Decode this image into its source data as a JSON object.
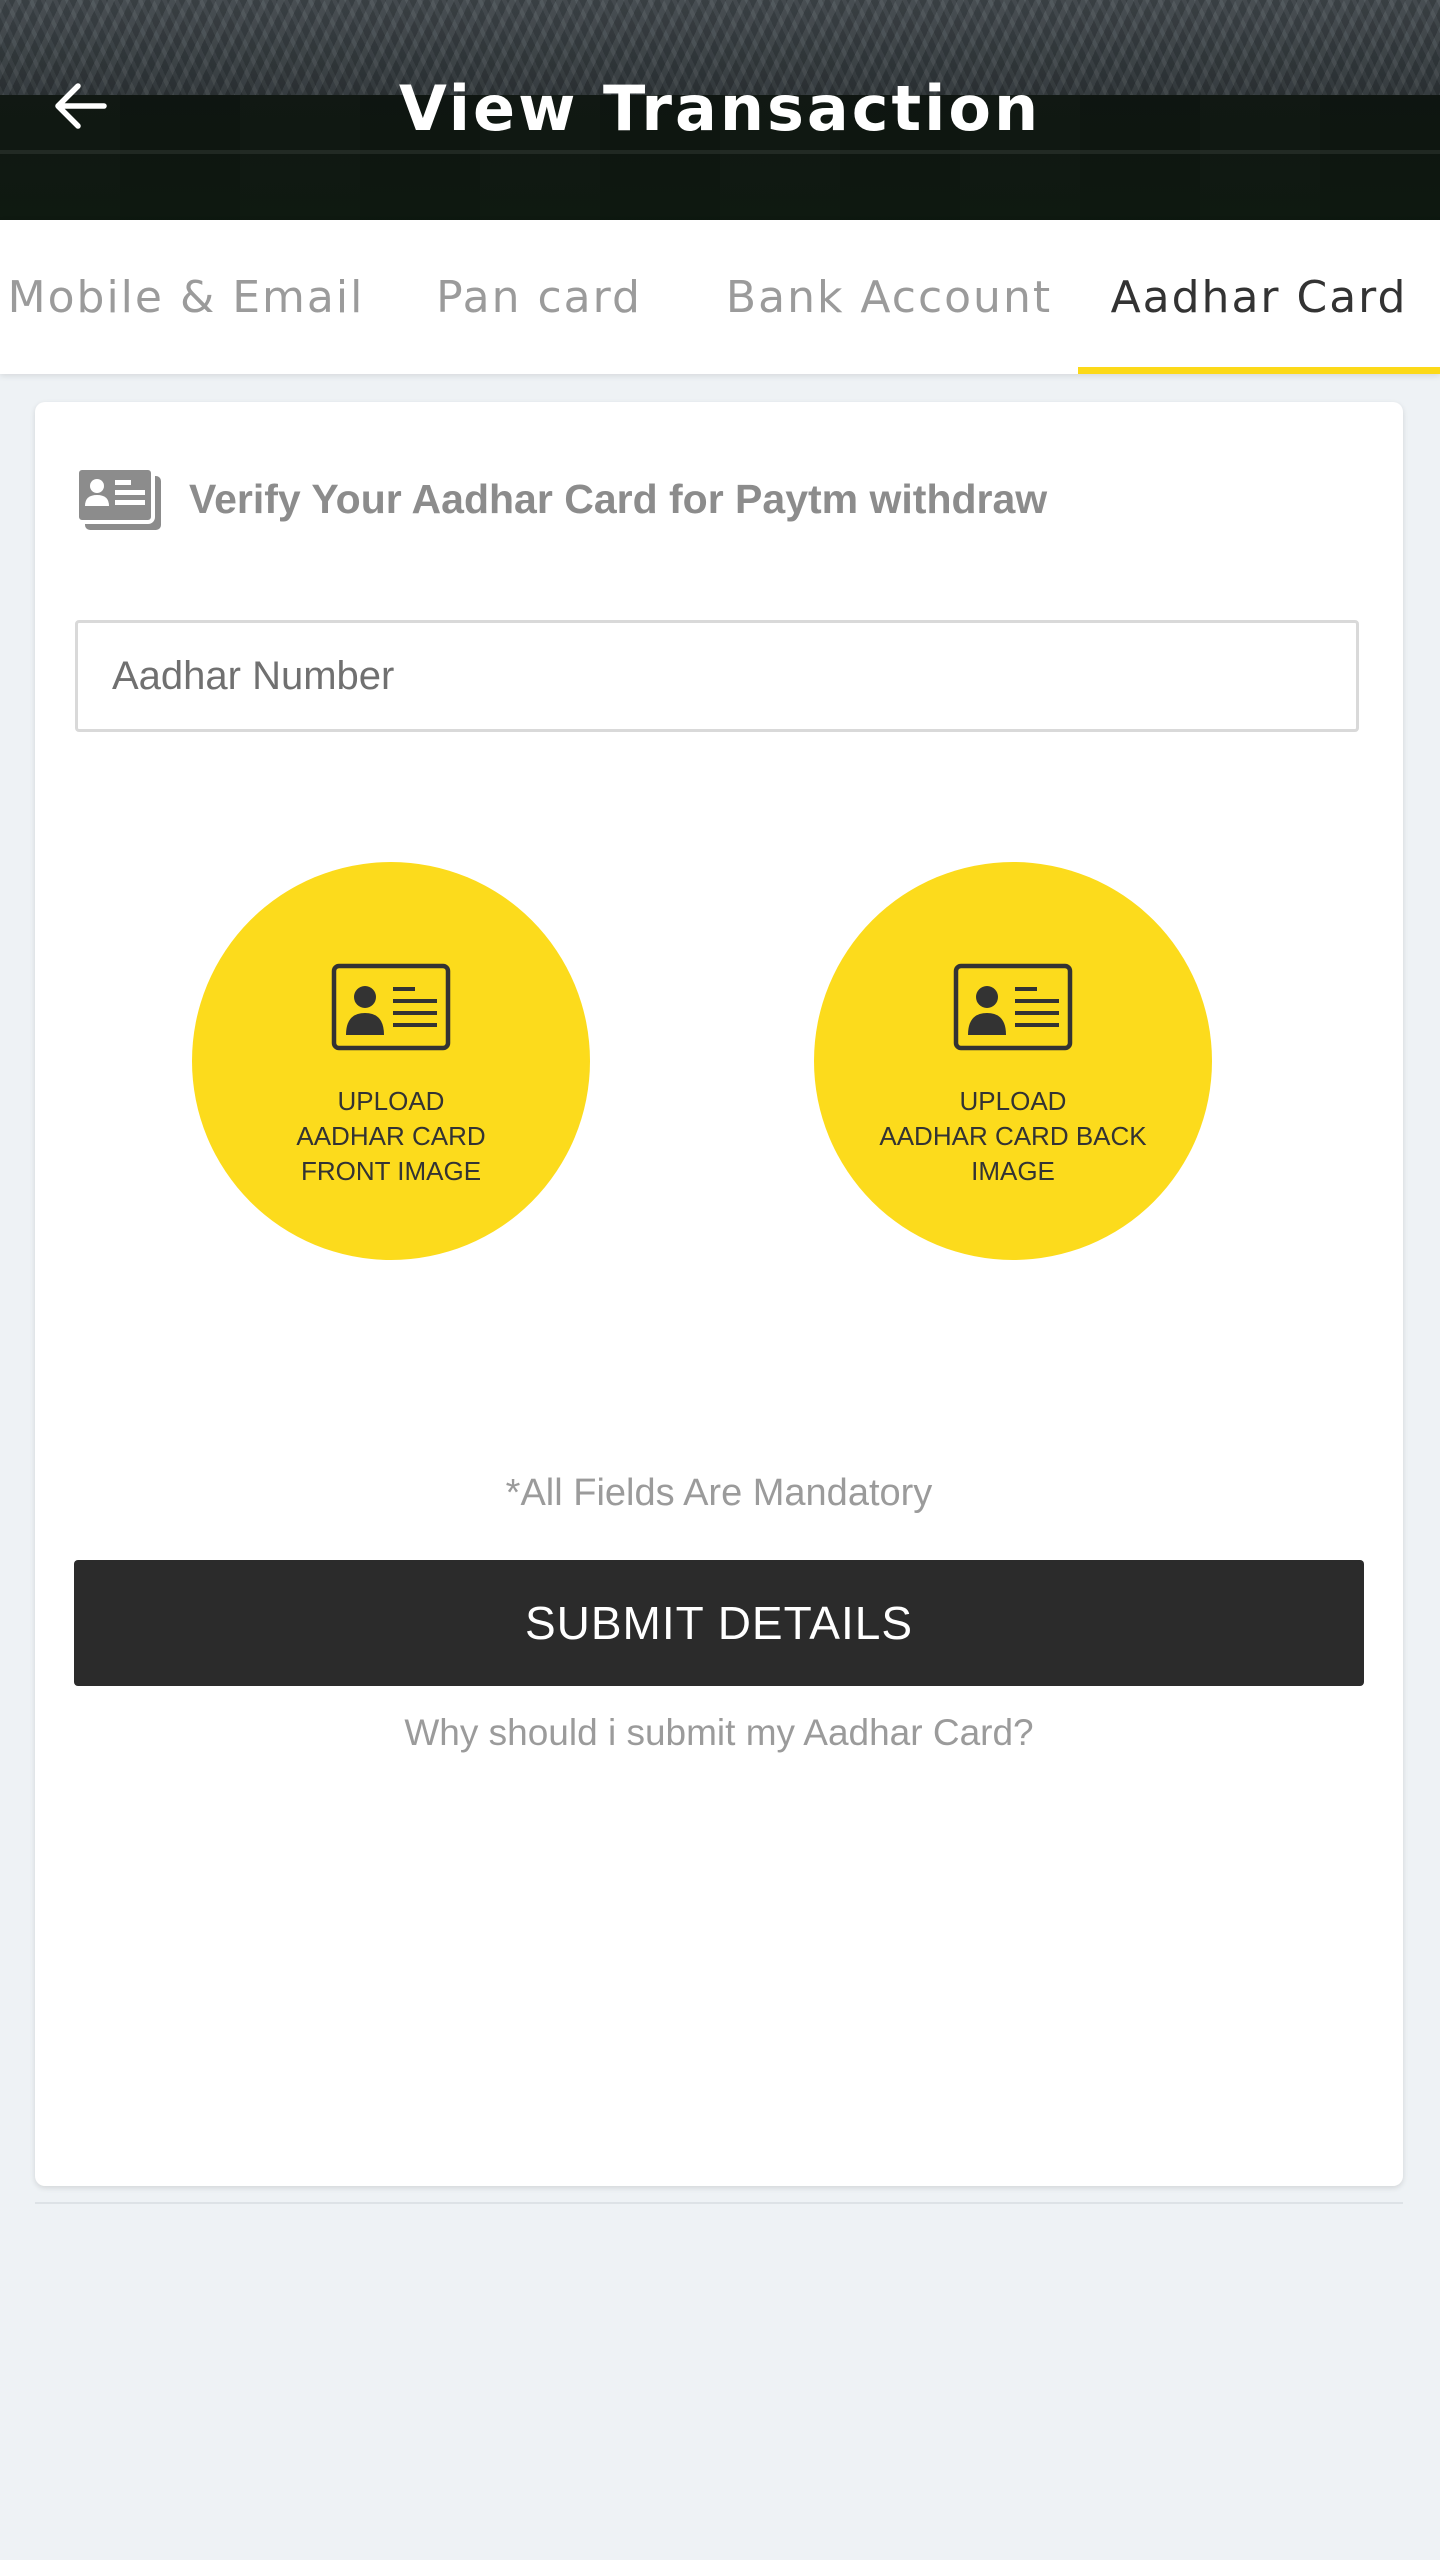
{
  "header": {
    "title": "View Transaction",
    "back_icon": "arrow-left-icon"
  },
  "tabs": [
    {
      "label": "Mobile & Email",
      "active": false
    },
    {
      "label": "Pan card",
      "active": false
    },
    {
      "label": "Bank Account",
      "active": false
    },
    {
      "label": "Aadhar Card",
      "active": true
    }
  ],
  "card": {
    "heading": "Verify Your Aadhar Card for Paytm withdraw",
    "heading_icon": "id-card-icon",
    "aadhar_input": {
      "placeholder": "Aadhar Number",
      "value": ""
    },
    "uploads": [
      {
        "lines": [
          "UPLOAD",
          "AADHAR CARD",
          "FRONT IMAGE"
        ],
        "icon": "id-card-icon"
      },
      {
        "lines": [
          "UPLOAD",
          "AADHAR CARD BACK",
          "IMAGE"
        ],
        "icon": "id-card-icon"
      }
    ],
    "mandatory_note": "*All Fields Are Mandatory",
    "submit_label": "SUBMIT DETAILS",
    "why_link": "Why should i submit my Aadhar Card?"
  },
  "colors": {
    "accent": "#fcdb1c",
    "button": "#2b2b2b",
    "page_background": "#eef2f5"
  }
}
